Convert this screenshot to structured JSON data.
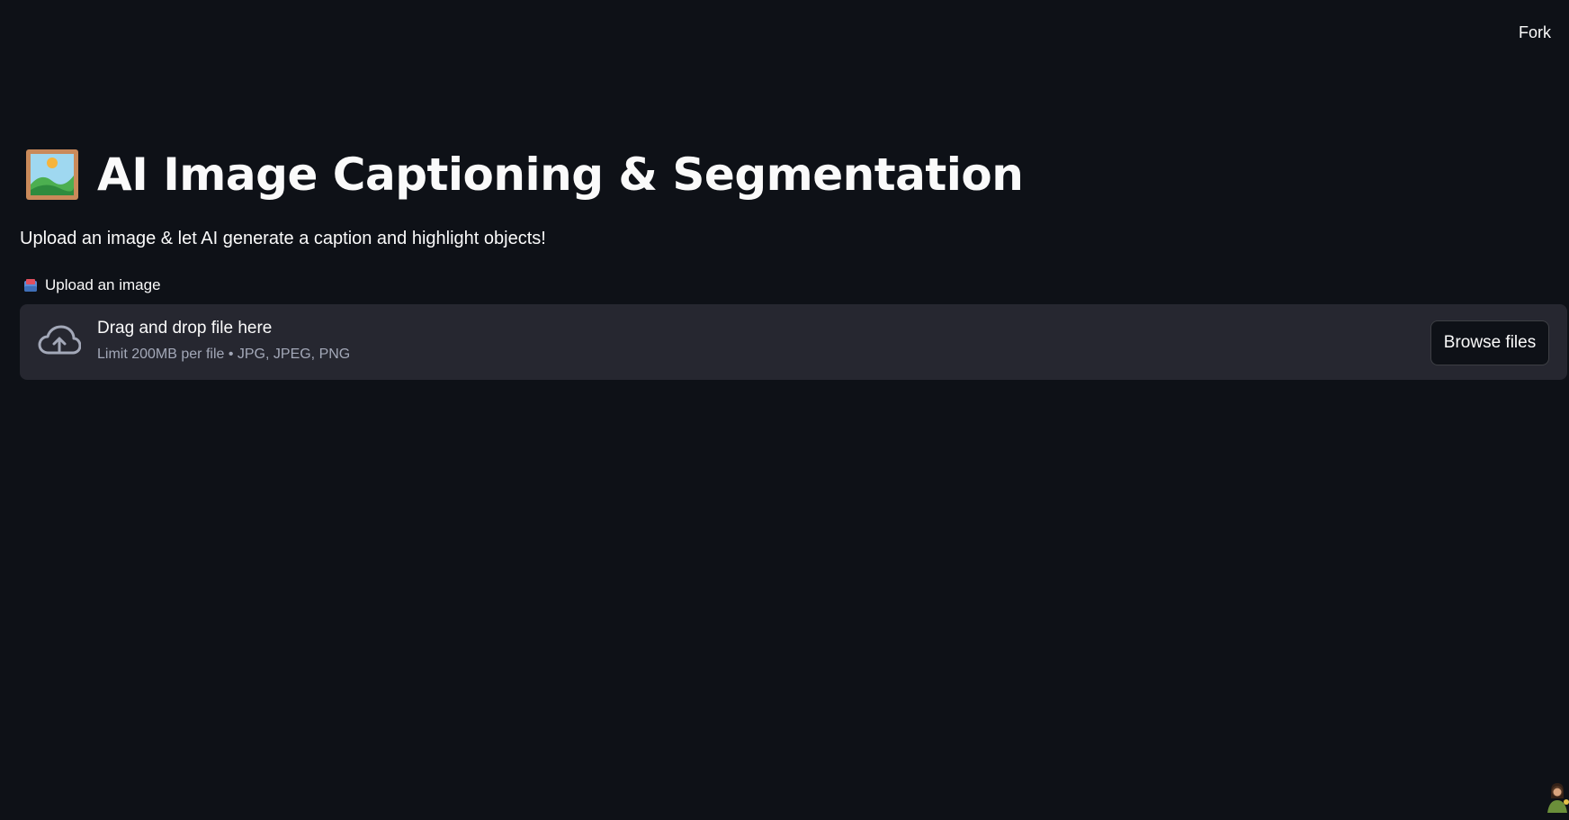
{
  "header": {
    "fork_label": "Fork"
  },
  "main": {
    "title_icon": "framed-picture-icon",
    "title": "AI Image Captioning & Segmentation",
    "subtitle": "Upload an image & let AI generate a caption and highlight objects!"
  },
  "uploader": {
    "label_icon": "inbox-tray-icon",
    "label": "Upload an image",
    "dropzone_icon": "cloud-upload-icon",
    "dropzone_title": "Drag and drop file here",
    "dropzone_limit": "Limit 200MB per file • JPG, JPEG, PNG",
    "browse_label": "Browse files"
  },
  "colors": {
    "background": "#0e1117",
    "dropzone": "#262730",
    "text": "#fafafa",
    "muted_text": "#a3a8b8"
  }
}
